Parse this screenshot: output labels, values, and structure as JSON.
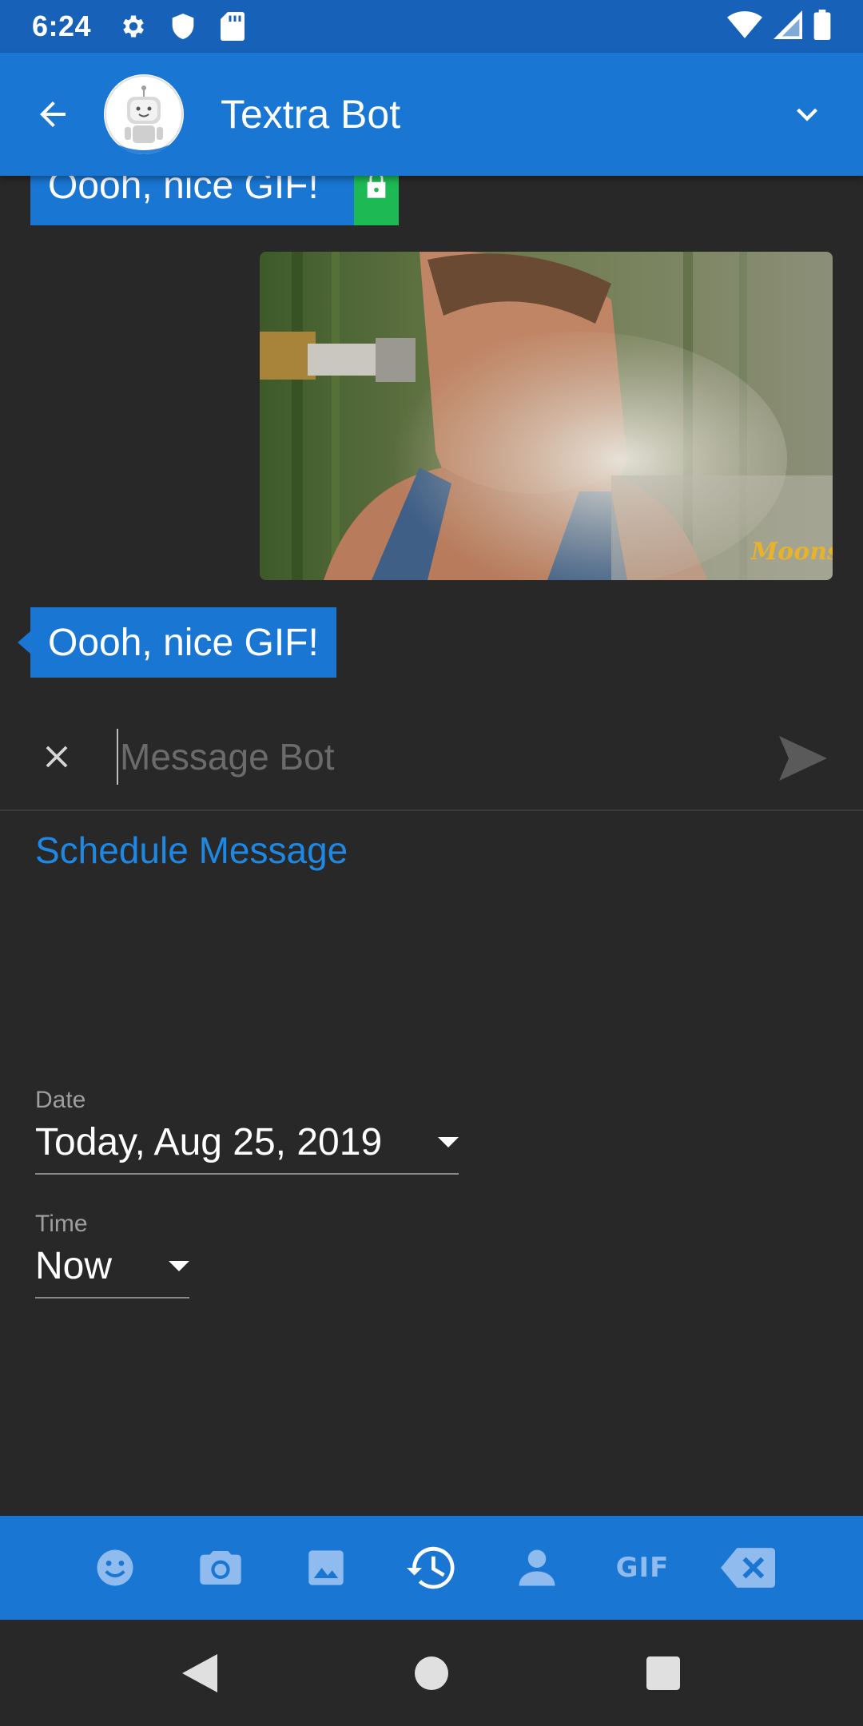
{
  "status_bar": {
    "time": "6:24",
    "left_icons": [
      "settings-icon",
      "shield-icon",
      "sd-card-icon"
    ],
    "right_icons": [
      "wifi-icon",
      "signal-icon",
      "battery-icon"
    ]
  },
  "app_bar": {
    "contact_name": "Textra Bot",
    "avatar": "robot-avatar",
    "bg_color": "#1976D2"
  },
  "conversation": {
    "messages": [
      {
        "type": "text",
        "text": "Oooh, nice GIF!",
        "encrypted": true
      },
      {
        "type": "gif",
        "watermark": "Moonshiners"
      },
      {
        "type": "text",
        "text": "Oooh, nice GIF!",
        "encrypted": false
      }
    ]
  },
  "composer": {
    "placeholder": "Message Bot",
    "value": ""
  },
  "schedule": {
    "title": "Schedule Message",
    "date_label": "Date",
    "date_value": "Today, Aug 25, 2019",
    "time_label": "Time",
    "time_value": "Now",
    "accent_color": "#1E88E5"
  },
  "toolbar": {
    "items": [
      "emoji-icon",
      "camera-icon",
      "image-icon",
      "schedule-icon",
      "contact-icon",
      "gif-icon",
      "delete-icon"
    ],
    "gif_label": "GIF"
  },
  "nav_bar": {
    "items": [
      "back-triangle-icon",
      "home-circle-icon",
      "recents-square-icon"
    ]
  }
}
